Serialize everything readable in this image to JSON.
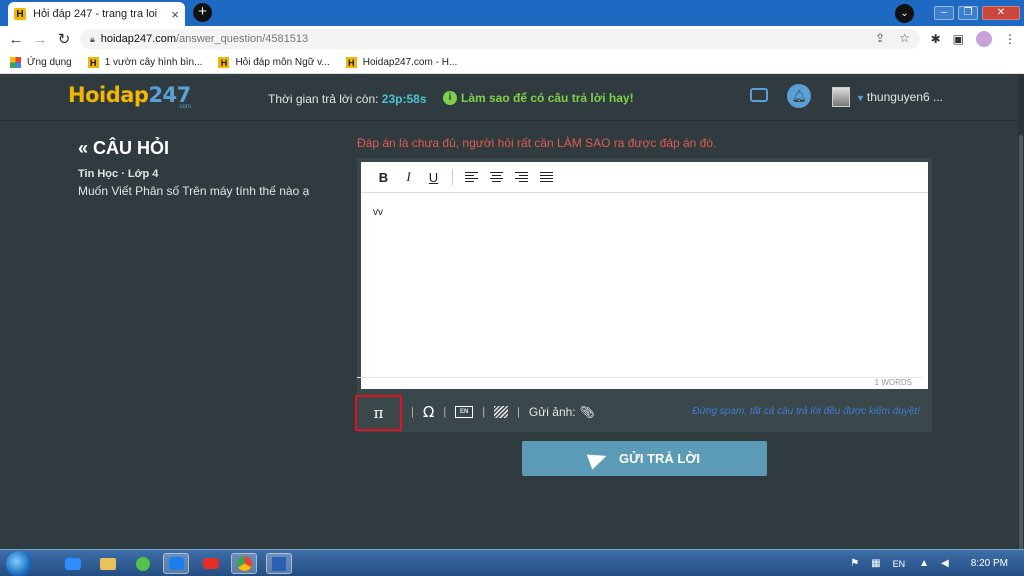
{
  "browser": {
    "tab_title": "Hỏi đáp 247 - trang tra loi",
    "tab_close": "×",
    "new_tab": "+",
    "url_host": "hoidap247.com",
    "url_path": "/answer_question/4581513",
    "bookmarks": [
      {
        "label": "Ứng dụng"
      },
      {
        "label": "1 vườn cây hình bìn..."
      },
      {
        "label": "Hỏi đáp môn Ngữ v..."
      },
      {
        "label": "Hoidap247.com - H..."
      }
    ]
  },
  "site": {
    "logo_a": "Hoidap",
    "logo_b": "247",
    "logo_sub": ".com",
    "timer_label": "Thời gian trả lời còn:",
    "timer_value": "23p:58s",
    "tip_text": "Làm sao để có câu trả lời hay!",
    "username": "thunguyen6 ..."
  },
  "question": {
    "heading": "« CÂU HỎI",
    "meta": "Tin Học · Lớp 4",
    "text": "Muốn Viết Phân số Trên máy tính thế nào ạ"
  },
  "editor": {
    "warning": "Đáp án là chưa đủ, người hỏi rất cần LÀM SAO ra được đáp án đó.",
    "content": "vv",
    "word_count": "1 WORDS",
    "pi_symbol": "π",
    "omega_symbol": "Ω",
    "en_label": "EN",
    "attach_label": "Gửi ảnh:",
    "spam_note": "Đừng spam, tất cả câu trả lời đều được kiểm duyệt!",
    "separator": "|"
  },
  "submit_label": "GỬI TRẢ LỜI",
  "taskbar": {
    "lang": "EN",
    "time": "8:20 PM"
  }
}
